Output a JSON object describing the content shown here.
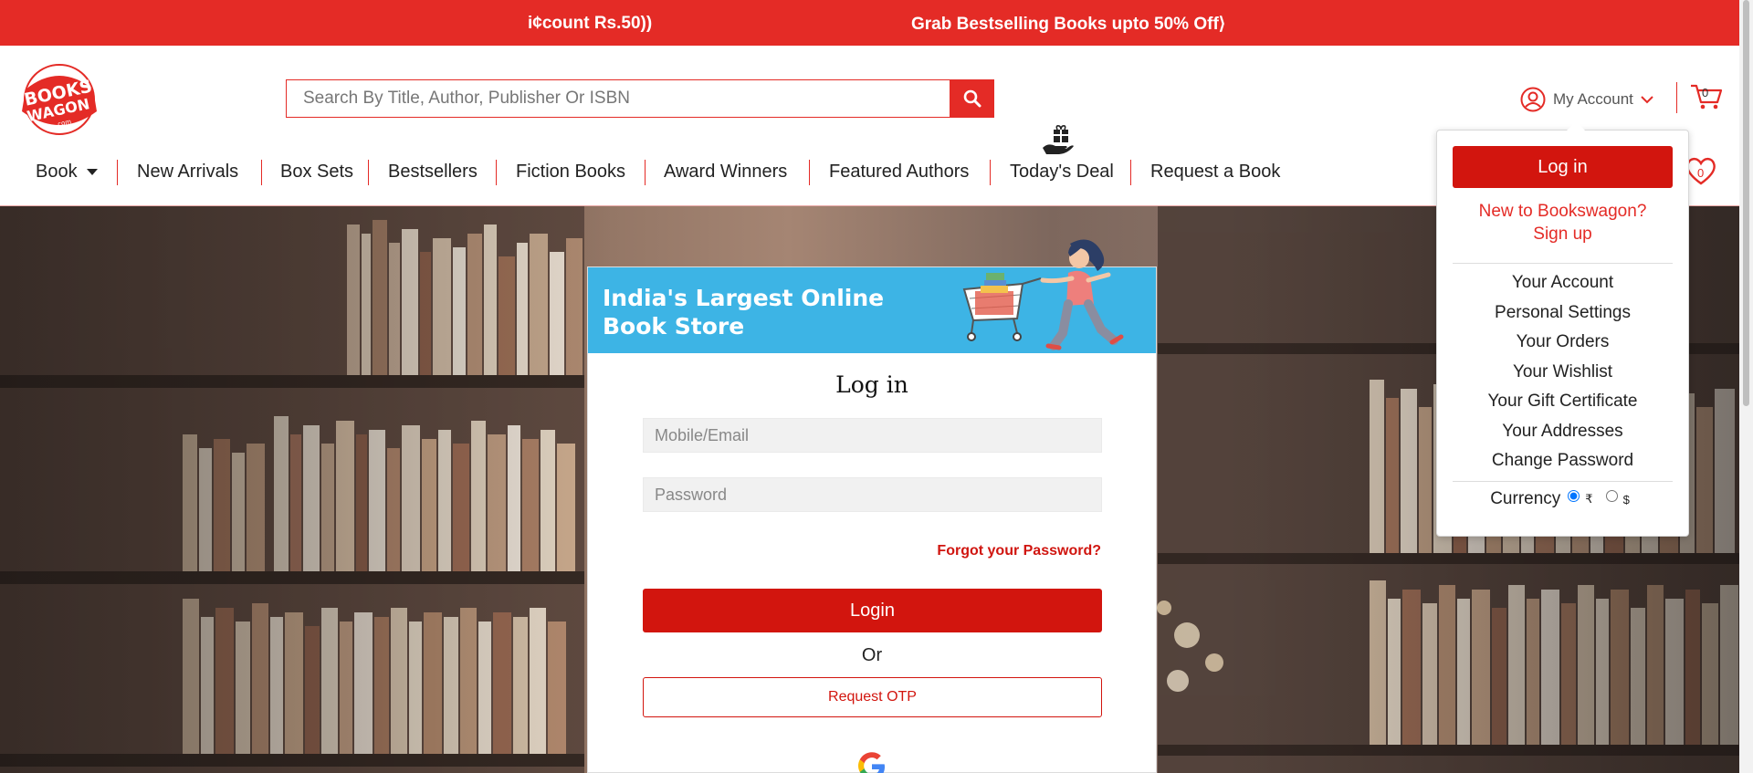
{
  "announcement": {
    "left_text": "Discount Rs.50))",
    "left_visible": "i¢count Rs.50))",
    "right_text": "Grab Bestselling Books upto 50% Off⟩"
  },
  "logo": {
    "line1": "BOOKS",
    "line2": "WAGON",
    "line3": ".com"
  },
  "search": {
    "placeholder": "Search By Title, Author, Publisher Or ISBN",
    "value": ""
  },
  "account": {
    "label": "My Account",
    "cart_count": "0",
    "wishlist_count": "0"
  },
  "nav": {
    "items": [
      {
        "label": "Book"
      },
      {
        "label": "New Arrivals"
      },
      {
        "label": "Box Sets"
      },
      {
        "label": "Bestsellers"
      },
      {
        "label": "Fiction Books"
      },
      {
        "label": "Award Winners"
      },
      {
        "label": "Featured Authors"
      },
      {
        "label": "Today's Deal"
      },
      {
        "label": "Request a Book"
      }
    ]
  },
  "login_card": {
    "banner_line1": "India's Largest Online",
    "banner_line2": "Book Store",
    "title": "Log in",
    "mobile_placeholder": "Mobile/Email",
    "password_placeholder": "Password",
    "forgot": "Forgot your Password?",
    "login_button": "Login",
    "or": "Or",
    "otp_button": "Request OTP"
  },
  "dropdown": {
    "login_button": "Log in",
    "new_line1": "New to Bookswagon?",
    "new_line2": "Sign up",
    "items": [
      "Your Account",
      "Personal Settings",
      "Your Orders",
      "Your Wishlist",
      "Your Gift Certificate",
      "Your Addresses",
      "Change Password"
    ],
    "currency_label": "Currency",
    "currency_options": [
      "₹",
      "$"
    ],
    "currency_selected": "₹"
  },
  "colors": {
    "brand_red": "#e42b26",
    "button_red": "#d2150e",
    "banner_blue": "#3db4e5"
  }
}
